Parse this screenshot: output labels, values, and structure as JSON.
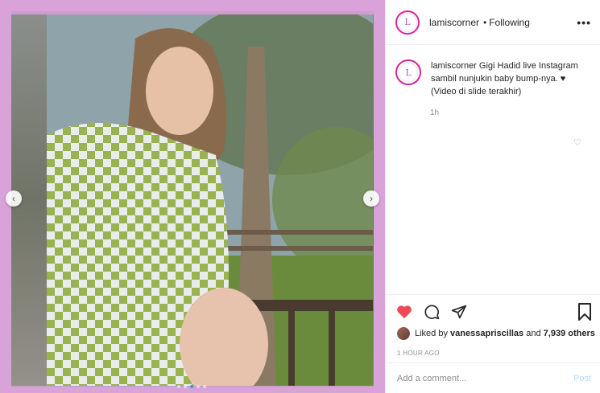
{
  "header": {
    "username": "lamiscorner",
    "separator": "•",
    "follow_status": "Following",
    "more": "•••",
    "avatar_letter": "L"
  },
  "media": {
    "prev_arrow": "‹",
    "next_arrow": "›",
    "slides_total": 5,
    "slide_active": 3
  },
  "caption": {
    "username": "lamiscorner",
    "text": "Gigi Hadid live Instagram sambil nunjukin baby bump-nya. ♥ (Video di slide terakhir)",
    "time": "1h"
  },
  "actions": {
    "like_icon": "heart-filled-icon",
    "comment_icon": "comment-icon",
    "share_icon": "send-icon",
    "save_icon": "bookmark-icon",
    "liked_by_prefix": "Liked by",
    "liked_by_user": "vanessapriscillas",
    "liked_by_and": "and",
    "liked_by_others": "7,939 others",
    "posted_ago": "1 HOUR AGO"
  },
  "comment": {
    "placeholder": "Add a comment...",
    "post_label": "Post"
  },
  "colors": {
    "like": "#ed4956",
    "post_disabled": "#b2dffc",
    "frame": "#d9a3d9"
  }
}
